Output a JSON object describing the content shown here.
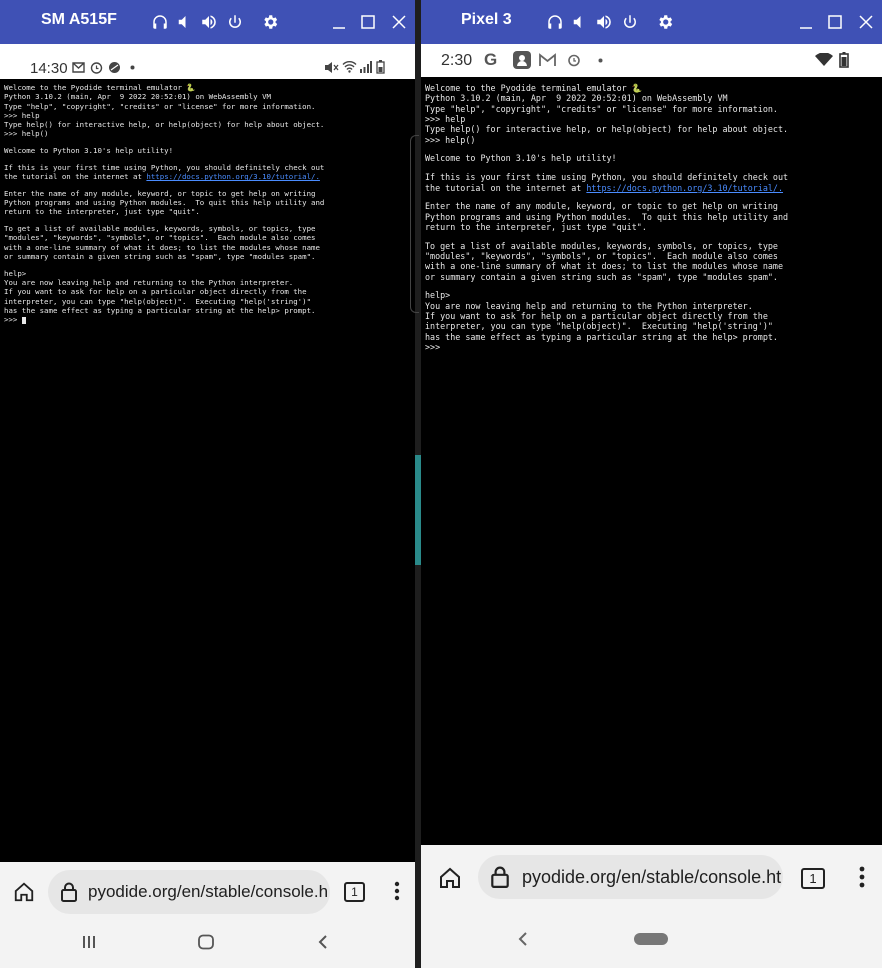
{
  "left_device": {
    "name": "SM A515F",
    "status_time": "14:30",
    "terminal_lines": [
      "Welcome to the Pyodide terminal emulator 🐍",
      "Python 3.10.2 (main, Apr  9 2022 20:52:01) on WebAssembly VM",
      "Type \"help\", \"copyright\", \"credits\" or \"license\" for more information.",
      ">>> help",
      "Type help() for interactive help, or help(object) for help about object.",
      ">>> help()",
      "",
      "Welcome to Python 3.10's help utility!",
      "",
      "If this is your first time using Python, you should definitely check out",
      "the tutorial on the internet at ",
      "",
      "Enter the name of any module, keyword, or topic to get help on writing",
      "Python programs and using Python modules.  To quit this help utility and",
      "return to the interpreter, just type \"quit\".",
      "",
      "To get a list of available modules, keywords, symbols, or topics, type",
      "\"modules\", \"keywords\", \"symbols\", or \"topics\".  Each module also comes",
      "with a one-line summary of what it does; to list the modules whose name",
      "or summary contain a given string such as \"spam\", type \"modules spam\".",
      "",
      "help>",
      "You are now leaving help and returning to the Python interpreter.",
      "If you want to ask for help on a particular object directly from the",
      "interpreter, you can type \"help(object)\".  Executing \"help('string')\"",
      "has the same effect as typing a particular string at the help> prompt.",
      ">>> "
    ],
    "tutorial_link": "https://docs.python.org/3.10/tutorial/.",
    "url": "pyodide.org/en/stable/console.h",
    "tab_count": "1"
  },
  "right_device": {
    "name": "Pixel 3",
    "status_time": "2:30",
    "status_g": "G",
    "terminal_lines": [
      "Welcome to the Pyodide terminal emulator 🐍",
      "Python 3.10.2 (main, Apr  9 2022 20:52:01) on WebAssembly VM",
      "Type \"help\", \"copyright\", \"credits\" or \"license\" for more information.",
      ">>> help",
      "Type help() for interactive help, or help(object) for help about object.",
      ">>> help()",
      "",
      "Welcome to Python 3.10's help utility!",
      "",
      "If this is your first time using Python, you should definitely check out",
      "the tutorial on the internet at ",
      "",
      "Enter the name of any module, keyword, or topic to get help on writing",
      "Python programs and using Python modules.  To quit this help utility and",
      "return to the interpreter, just type \"quit\".",
      "",
      "To get a list of available modules, keywords, symbols, or topics, type",
      "\"modules\", \"keywords\", \"symbols\", or \"topics\".  Each module also comes",
      "with a one-line summary of what it does; to list the modules whose name",
      "or summary contain a given string such as \"spam\", type \"modules spam\".",
      "",
      "help>",
      "You are now leaving help and returning to the Python interpreter.",
      "If you want to ask for help on a particular object directly from the",
      "interpreter, you can type \"help(object)\".  Executing \"help('string')\"",
      "has the same effect as typing a particular string at the help> prompt.",
      ">>>"
    ],
    "tutorial_link": "https://docs.python.org/3.10/tutorial/.",
    "url": "pyodide.org/en/stable/console.ht",
    "tab_count": "1"
  },
  "colors": {
    "titlebar": "#3f51b5",
    "terminal_bg": "#000000",
    "terminal_text": "#e8e8e8",
    "link": "#4a8cff"
  }
}
